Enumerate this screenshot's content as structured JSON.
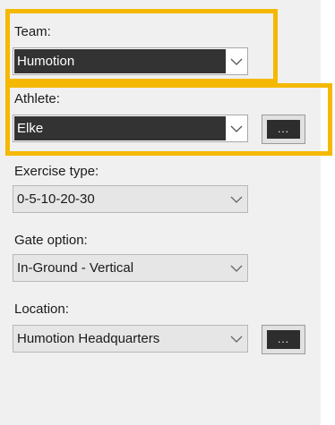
{
  "team": {
    "label": "Team:",
    "value": "Humotion"
  },
  "athlete": {
    "label": "Athlete:",
    "value": "Elke",
    "browse_label": "..."
  },
  "exercise_type": {
    "label": "Exercise type:",
    "value": "0-5-10-20-30"
  },
  "gate_option": {
    "label": "Gate option:",
    "value": "In-Ground - Vertical"
  },
  "location": {
    "label": "Location:",
    "value": "Humotion Headquarters",
    "browse_label": "..."
  },
  "icons": {
    "dropdown": "chevron-down-icon"
  },
  "colors": {
    "highlight": "#f5b800",
    "selection": "#333333",
    "panel": "#f0f0f0"
  }
}
